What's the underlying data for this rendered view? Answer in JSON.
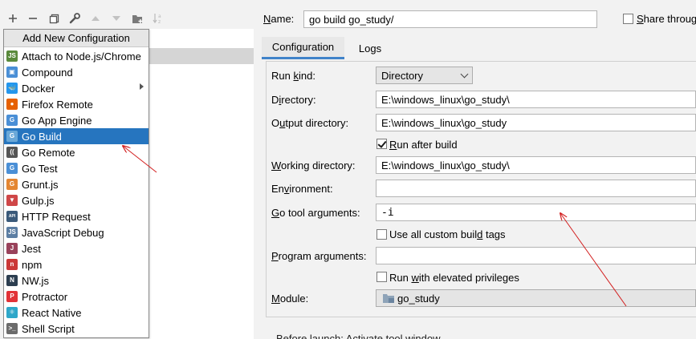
{
  "toolbar": {
    "buttons": [
      {
        "icon": "plus-icon"
      },
      {
        "icon": "minus-icon"
      },
      {
        "icon": "copy-icon"
      },
      {
        "icon": "wrench-icon"
      },
      {
        "icon": "arrow-up-icon"
      },
      {
        "icon": "arrow-down-icon"
      },
      {
        "icon": "new-folder-icon"
      },
      {
        "icon": "sort-alpha-icon"
      }
    ]
  },
  "popup": {
    "title": "Add New Configuration",
    "items": [
      {
        "label": "Attach to Node.js/Chrome",
        "icon": "nodejs-attach-icon",
        "color": "#5a8a3c"
      },
      {
        "label": "Compound",
        "icon": "compound-icon",
        "color": "#4a8fd6"
      },
      {
        "label": "Docker",
        "icon": "docker-icon",
        "color": "#2496ed",
        "submenu": true
      },
      {
        "label": "Firefox Remote",
        "icon": "firefox-icon",
        "color": "#e66000"
      },
      {
        "label": "Go App Engine",
        "icon": "go-app-engine-icon",
        "color": "#4a8fd6"
      },
      {
        "label": "Go Build",
        "icon": "go-build-icon",
        "color": "#6aa8d8",
        "selected": true
      },
      {
        "label": "Go Remote",
        "icon": "go-remote-icon",
        "color": "#555555"
      },
      {
        "label": "Go Test",
        "icon": "go-test-icon",
        "color": "#4a8fd6"
      },
      {
        "label": "Grunt.js",
        "icon": "grunt-icon",
        "color": "#e48632"
      },
      {
        "label": "Gulp.js",
        "icon": "gulp-icon",
        "color": "#cf4647"
      },
      {
        "label": "HTTP Request",
        "icon": "http-api-icon",
        "color": "#3b5a7a"
      },
      {
        "label": "JavaScript Debug",
        "icon": "javascript-debug-icon",
        "color": "#5c7ea3"
      },
      {
        "label": "Jest",
        "icon": "jest-icon",
        "color": "#99425b"
      },
      {
        "label": "npm",
        "icon": "npm-icon",
        "color": "#cb3837"
      },
      {
        "label": "NW.js",
        "icon": "nwjs-icon",
        "color": "#2c3e50"
      },
      {
        "label": "Protractor",
        "icon": "protractor-icon",
        "color": "#e23237"
      },
      {
        "label": "React Native",
        "icon": "react-icon",
        "color": "#2ea7c9"
      },
      {
        "label": "Shell Script",
        "icon": "shell-script-icon",
        "color": "#6b6b6b"
      }
    ]
  },
  "header": {
    "name_label": "Name:",
    "name_value": "go build go_study/",
    "share_label": "Share through VCS"
  },
  "tabs": [
    {
      "label": "Configuration",
      "active": true
    },
    {
      "label": "Logs",
      "active": false
    }
  ],
  "config": {
    "run_kind": {
      "label": "Run kind:",
      "value": "Directory"
    },
    "directory": {
      "label": "Directory:",
      "value": "E:\\windows_linux\\go_study\\"
    },
    "output_directory": {
      "label": "Output directory:",
      "value": "E:\\windows_linux\\go_study"
    },
    "run_after_build": {
      "label": "Run after build",
      "checked": true
    },
    "working_directory": {
      "label": "Working directory:",
      "value": "E:\\windows_linux\\go_study\\"
    },
    "environment": {
      "label": "Environment:",
      "value": ""
    },
    "go_tool_arguments": {
      "label": "Go tool arguments:",
      "value": "-i"
    },
    "use_custom_build_tags": {
      "label": "Use all custom build tags",
      "checked": false
    },
    "program_arguments": {
      "label": "Program arguments:",
      "value": ""
    },
    "run_elevated": {
      "label": "Run with elevated privileges",
      "checked": false
    },
    "module": {
      "label": "Module:",
      "value": "go_study",
      "icon": "module-folder-icon"
    }
  },
  "footer": {
    "text": "Before launch: Activate tool window"
  },
  "colors": {
    "selection": "#2675bf",
    "annotation_arrow": "#d21e1e",
    "tab_underline": "#4083c9"
  }
}
